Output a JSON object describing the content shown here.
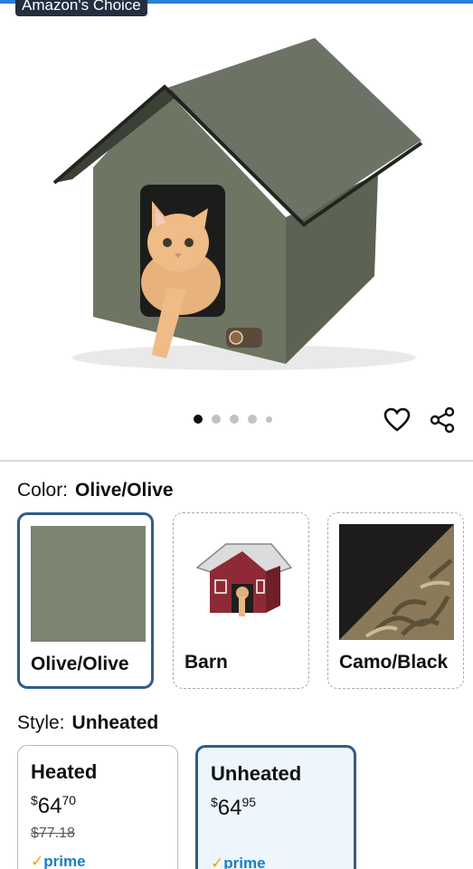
{
  "badge": "Amazon's Choice",
  "gallery": {
    "total_dots": 5,
    "active_index": 0
  },
  "color": {
    "label": "Color:",
    "selected": "Olive/Olive",
    "options": [
      {
        "name": "Olive/Olive",
        "swatch": "#7d8472"
      },
      {
        "name": "Barn"
      },
      {
        "name": "Camo/Black"
      }
    ]
  },
  "style": {
    "label": "Style:",
    "selected": "Unheated",
    "options": [
      {
        "name": "Heated",
        "price_currency": "$",
        "price_whole": "64",
        "price_frac": "70",
        "list_price": "$77.18",
        "prime_check": "✓",
        "prime_word": "prime"
      },
      {
        "name": "Unheated",
        "price_currency": "$",
        "price_whole": "64",
        "price_frac": "95",
        "prime_check": "✓",
        "prime_word": "prime"
      }
    ]
  },
  "colors": {
    "accent": "#2f5d8a",
    "prime": "#1a7fc1",
    "badge_bg": "#232f3e",
    "top_strip": "#2a7fd6"
  }
}
